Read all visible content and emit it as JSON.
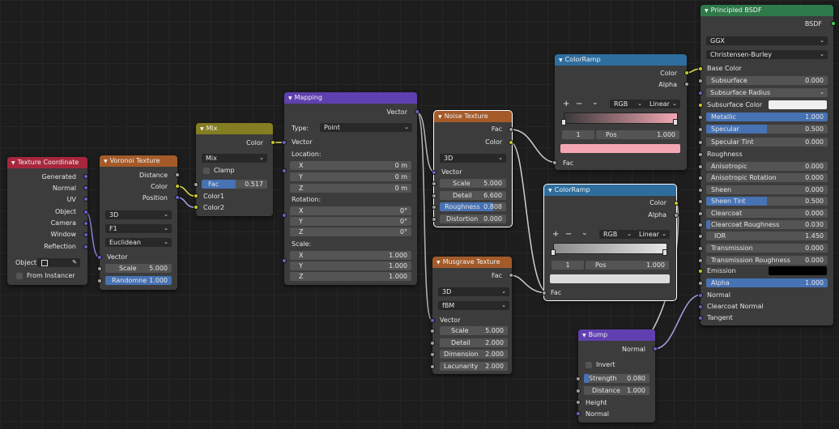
{
  "nodes": {
    "tex_coord": {
      "title": "Texture Coordinate",
      "outputs": [
        "Generated",
        "Normal",
        "UV",
        "Object",
        "Camera",
        "Window",
        "Reflection"
      ],
      "object_label": "Object",
      "from_instancer": "From Instancer"
    },
    "voronoi": {
      "title": "Voronoi Texture",
      "outputs": [
        "Distance",
        "Color",
        "Position"
      ],
      "dims": "3D",
      "feature": "F1",
      "metric": "Euclidean",
      "vector": "Vector",
      "scale_label": "Scale",
      "scale_value": "5.000",
      "random_label": "Randomne",
      "random_value": "1.000"
    },
    "mix": {
      "title": "Mix",
      "out_color": "Color",
      "blend": "Mix",
      "clamp": "Clamp",
      "fac_label": "Fac",
      "fac_value": "0.517",
      "color1": "Color1",
      "color2": "Color2"
    },
    "mapping": {
      "title": "Mapping",
      "out_vector": "Vector",
      "type_label": "Type:",
      "type_value": "Point",
      "in_vector": "Vector",
      "location": "Location:",
      "loc": [
        {
          "axis": "X",
          "value": "0 m"
        },
        {
          "axis": "Y",
          "value": "0 m"
        },
        {
          "axis": "Z",
          "value": "0 m"
        }
      ],
      "rotation": "Rotation:",
      "rot": [
        {
          "axis": "X",
          "value": "0°"
        },
        {
          "axis": "Y",
          "value": "0°"
        },
        {
          "axis": "Z",
          "value": "0°"
        }
      ],
      "scale": "Scale:",
      "scl": [
        {
          "axis": "X",
          "value": "1.000"
        },
        {
          "axis": "Y",
          "value": "1.000"
        },
        {
          "axis": "Z",
          "value": "1.000"
        }
      ]
    },
    "noise": {
      "title": "Noise Texture",
      "out_fac": "Fac",
      "out_color": "Color",
      "dims": "3D",
      "vector": "Vector",
      "scale_label": "Scale",
      "scale_value": "5.000",
      "detail_label": "Detail",
      "detail_value": "6.600",
      "rough_label": "Roughness",
      "rough_value": "0.808",
      "distort_label": "Distortion",
      "distort_value": "0.000"
    },
    "musgrave": {
      "title": "Musgrave Texture",
      "out_fac": "Fac",
      "dims": "3D",
      "type": "fBM",
      "vector": "Vector",
      "scale_label": "Scale",
      "scale_value": "5.000",
      "detail_label": "Detail",
      "detail_value": "2.000",
      "dim_label": "Dimension",
      "dim_value": "2.000",
      "lac_label": "Lacunarity",
      "lac_value": "2.000"
    },
    "ramp1": {
      "title": "ColorRamp",
      "out_color": "Color",
      "out_alpha": "Alpha",
      "mode": "RGB",
      "interp": "Linear",
      "index": "1",
      "pos_label": "Pos",
      "pos_value": "1.000",
      "fac": "Fac"
    },
    "ramp2": {
      "title": "ColorRamp",
      "out_color": "Color",
      "out_alpha": "Alpha",
      "mode": "RGB",
      "interp": "Linear",
      "index": "1",
      "pos_label": "Pos",
      "pos_value": "1.000",
      "fac": "Fac"
    },
    "bump": {
      "title": "Bump",
      "out_normal": "Normal",
      "invert": "Invert",
      "strength_label": "Strength",
      "strength_value": "0.080",
      "distance_label": "Distance",
      "distance_value": "1.000",
      "height": "Height",
      "normal": "Normal"
    },
    "bsdf": {
      "title": "Principled BSDF",
      "out": "BSDF",
      "distribution": "GGX",
      "sss_method": "Christensen-Burley",
      "base_color": "Base Color",
      "subsurface_label": "Subsurface",
      "subsurface_value": "0.000",
      "subsurface_radius": "Subsurface Radius",
      "subsurface_color": "Subsurface Color",
      "metallic_label": "Metallic",
      "metallic_value": "1.000",
      "specular_label": "Specular",
      "specular_value": "0.500",
      "spec_tint_label": "Specular Tint",
      "spec_tint_value": "0.000",
      "roughness": "Roughness",
      "aniso_label": "Anisotropic",
      "aniso_value": "0.000",
      "aniso_rot_label": "Anisotropic Rotation",
      "aniso_rot_value": "0.000",
      "sheen_label": "Sheen",
      "sheen_value": "0.000",
      "sheen_tint_label": "Sheen Tint",
      "sheen_tint_value": "0.500",
      "clearcoat_label": "Clearcoat",
      "clearcoat_value": "0.000",
      "cc_rough_label": "Clearcoat Roughness",
      "cc_rough_value": "0.030",
      "ior_label": "IOR",
      "ior_value": "1.450",
      "trans_label": "Transmission",
      "trans_value": "0.000",
      "trans_rough_label": "Transmission Roughness",
      "trans_rough_value": "0.000",
      "emission": "Emission",
      "alpha_label": "Alpha",
      "alpha_value": "1.000",
      "normal": "Normal",
      "clearcoat_normal": "Clearcoat Normal",
      "tangent": "Tangent"
    }
  },
  "ramp_controls": {
    "add": "+",
    "remove": "−",
    "menu": "⌄"
  },
  "colors": {
    "texture_header": "#a45b29",
    "input_header": "#a8263c",
    "color_header": "#857d22",
    "vector_header": "#6040b0",
    "converter_header": "#2e6e9e",
    "shader_header": "#2f7a4a",
    "pink_output": "#f4a7b3",
    "slider_blue": "#4772b3"
  }
}
